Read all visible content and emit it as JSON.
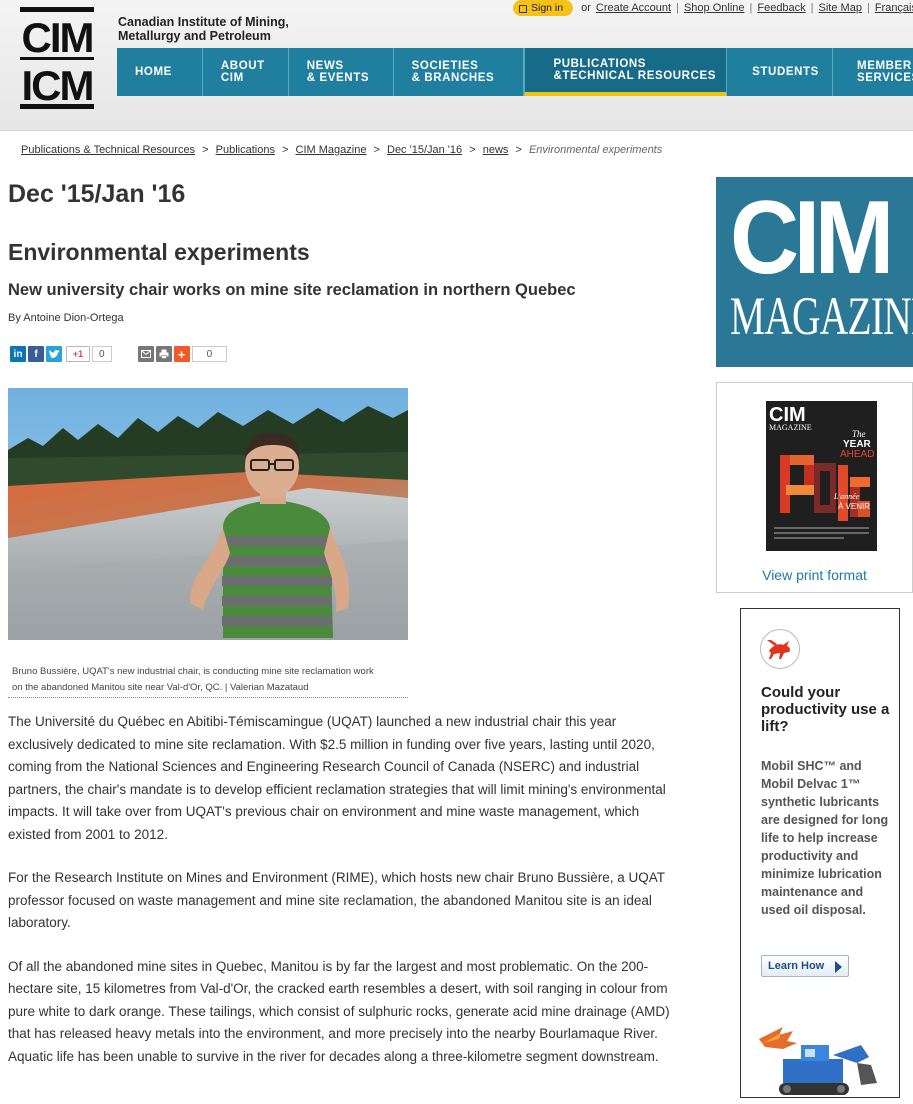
{
  "header": {
    "logo_text_top": "CIM",
    "logo_text_bottom": "ICM",
    "org_line1": "Canadian Institute of Mining,",
    "org_line2": "Metallurgy and Petroleum",
    "topbar": {
      "signin": "Sign in",
      "or": "or",
      "links": [
        "Create Account",
        "Shop Online",
        "Feedback",
        "Site Map",
        "Français"
      ]
    },
    "nav": [
      {
        "line1": "HOME",
        "line2": ""
      },
      {
        "line1": "ABOUT",
        "line2": "CIM"
      },
      {
        "line1": "NEWS",
        "line2": "& EVENTS"
      },
      {
        "line1": "SOCIETIES",
        "line2": "& BRANCHES"
      },
      {
        "line1": "PUBLICATIONS",
        "line2": "&TECHNICAL RESOURCES"
      },
      {
        "line1": "STUDENTS",
        "line2": ""
      },
      {
        "line1": "MEMBER",
        "line2": "SERVICES"
      }
    ]
  },
  "breadcrumb": {
    "items": [
      "Publications & Technical Resources",
      "Publications",
      "CIM Magazine",
      "Dec '15/Jan '16",
      "news"
    ],
    "separator": ">",
    "current": "Environmental experiments"
  },
  "article": {
    "issue": "Dec '15/Jan '16",
    "title": "Environmental experiments",
    "subtitle": "New university chair works on mine site reclamation in northern Quebec",
    "byline": "By Antoine Dion-Ortega",
    "share": {
      "gplus_label": "+1",
      "gplus_count": "0",
      "share_count": "0"
    },
    "caption_line1": "Bruno Bussière, UQAT's new industrial chair, is conducting mine site reclamation work",
    "caption_line2": "on the abandoned Manitou site near Val-d'Or, QC. | Valerian Mazataud",
    "paragraphs": [
      "The Université du Québec en Abitibi-Témiscamingue (UQAT) launched a new industrial chair this year exclusively dedicated to mine site reclamation. With $2.5 million in funding over five years, lasting until 2020, coming from the National Sciences and Engineering Research Council of Canada (NSERC) and industrial partners, the chair's mandate is to develop efficient reclamation strategies that will limit mining's environmental impacts. It will take over from UQAT's previous chair on environment and mine waste management, which existed from 2001 to 2012.",
      "For the Research Institute on Mines and Environment (RIME), which hosts new chair Bruno Bussière, a UQAT professor focused on waste management and mine site reclamation, the abandoned Manitou site is an ideal laboratory.",
      "Of all the abandoned mine sites in Quebec, Manitou is by far the largest and most problematic. On the 200-hectare site, 15 kilometres from Val-d'Or, the cracked earth resembles a desert, with soil ranging in colour from pure white to dark orange. These tailings, which consist of sulphuric rocks, generate acid mine drainage (AMD) that has released heavy metals into the environment, and more precisely into the nearby Bourlamaque River. Aquatic life has been unable to survive in the river for decades along a three-kilometre segment downstream."
    ]
  },
  "sidebar": {
    "mag_logo_top": "CIM",
    "mag_logo_bottom": "MAGAZINE",
    "cover": {
      "masthead": "CIM",
      "masthead_sub": "MAGAZINE",
      "headline_1": "The",
      "headline_2": "YEAR",
      "headline_3": "AHEAD",
      "headline_fr_1": "L'année",
      "headline_fr_2": "À VENIR",
      "year": "2016"
    },
    "print_link": "View print format",
    "ad": {
      "headline": "Could your productivity use a lift?",
      "body": "Mobil SHC™ and Mobil Delvac 1™ synthetic lubricants are designed for long life to help increase productivity and minimize lubrication maintenance and used oil disposal.",
      "cta": "Learn How"
    }
  },
  "colors": {
    "nav_blue": "#207e9e",
    "nav_active": "#176a88",
    "accent_yellow": "#f3c314",
    "link_blue": "#1b7aa7",
    "magazine_teal": "#2b7896"
  }
}
